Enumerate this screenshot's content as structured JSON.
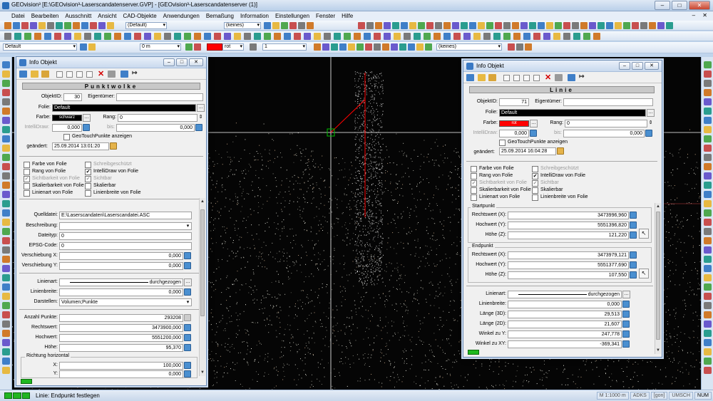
{
  "window": {
    "title": "GEOvision³  [E:\\GEOvision³-Laserscandatenserver.GVP] - [GEOvision³-Laserscandatenserver (1)]",
    "min": "–",
    "max": "□",
    "close": "✕"
  },
  "menu": [
    "Datei",
    "Bearbeiten",
    "Ausschnitt",
    "Ansicht",
    "CAD-Objekte",
    "Anwendungen",
    "Bemaßung",
    "Information",
    "Einstellungen",
    "Fenster",
    "Hilfe"
  ],
  "menu_mdi_buttons": "– ✕",
  "toolbar": {
    "layer_combo": "(Default)",
    "snap_combo": "(keines)"
  },
  "toolbar2": {
    "style_combo": "Default",
    "width_combo": "0 m",
    "color_label": "rot",
    "number_value": "1",
    "keines_combo": "(keines)"
  },
  "status": {
    "message": "Linie: Endpunkt festlegen",
    "cells": [
      "M 1:1000 m",
      "ADKS",
      "[gon]",
      "UMSCH",
      "NUM"
    ]
  },
  "colors": {
    "accent_red": "#ff0000",
    "green": "#1fb81f"
  },
  "left_panel": {
    "title": "Info Objekt",
    "header": "Punktwolke",
    "objektid_label": "ObjektID:",
    "objektid": "30",
    "eigentuemer_label": "Eigentümer:",
    "folie_label": "Folie:",
    "folie": "Default",
    "farbe_label": "Farbe:",
    "farbe": "schwarz",
    "rang_label": "Rang:",
    "rang": "0",
    "intellidraw_label": "IntelliDraw:",
    "intellidraw": "0,000",
    "bis_label": "bis:",
    "bis": "0,000",
    "geotouch": "GeoTouchPunkte anzeigen",
    "geaendert_label": "geändert:",
    "geaendert": "25.09.2014 13:01:20",
    "checks_left": [
      "Farbe von Folie",
      "Rang von Folie",
      "Sichtbarkeit von Folie",
      "Skalierbarkeit von Folie",
      "Linienart von Folie"
    ],
    "checks_right": [
      "Schreibgeschützt",
      "IntelliDraw von Folie",
      "Sichtbar",
      "Skalierbar",
      "Linienbreite von Folie"
    ],
    "quelldatei_label": "Quelldatei:",
    "quelldatei": "E:\\Laserscandaten\\Laserscandatei.ASC",
    "beschreibung_label": "Beschreibung:",
    "dateityp_label": "Dateityp:",
    "dateityp": "0",
    "epsg_label": "EPSG-Code:",
    "epsg": "0",
    "verschx_label": "Verschiebung X:",
    "verschx": "0,000",
    "verschy_label": "Verschiebung Y:",
    "verschy": "0,000",
    "linienart_label": "Linienart:",
    "linienart": "durchgezogen",
    "linienbreite_label": "Linienbreite:",
    "linienbreite": "0,000",
    "darstellen_label": "Darstellen:",
    "darstellen": "Volumen;Punkte",
    "anzahl_label": "Anzahl Punkte:",
    "anzahl": "293208",
    "rechts_label": "Rechtswert:",
    "rechts": "3473900,000",
    "hoch_label": "Hochwert:",
    "hoch": "5551200,000",
    "hoehe_label": "Höhe:",
    "hoehe": "95,370",
    "richtung_label": "Richtung horizontal",
    "x_label": "X:",
    "x": "100,000",
    "y_label": "Y:",
    "y": "0,000"
  },
  "right_panel": {
    "title": "Info Objekt",
    "header": "Linie",
    "objektid_label": "ObjektID:",
    "objektid": "71",
    "eigentuemer_label": "Eigentümer:",
    "folie_label": "Folie:",
    "folie": "Default",
    "farbe_label": "Farbe:",
    "farbe": "rot",
    "rang_label": "Rang:",
    "rang": "0",
    "intellidraw_label": "IntelliDraw:",
    "intellidraw": "0,000",
    "bis_label": "bis:",
    "bis": "0,000",
    "geotouch": "GeoTouchPunkte anzeigen",
    "geaendert_label": "geändert:",
    "geaendert": "25.09.2014 16:04:28",
    "checks_left": [
      "Farbe von Folie",
      "Rang von Folie",
      "Sichtbarkeit von Folie",
      "Skalierbarkeit von Folie",
      "Linienart von Folie"
    ],
    "checks_right": [
      "Schreibgeschützt",
      "IntelliDraw von Folie",
      "Sichtbar",
      "Skalierbar",
      "Linienbreite von Folie"
    ],
    "startpunkt_label": "Startpunkt",
    "s_rechts_label": "Rechtswert (X):",
    "s_rechts": "3473996,960",
    "s_hoch_label": "Hochwert (Y):",
    "s_hoch": "5551396,820",
    "s_hoehe_label": "Höhe (Z):",
    "s_hoehe": "121,220",
    "endpunkt_label": "Endpunkt",
    "e_rechts_label": "Rechtswert (X):",
    "e_rechts": "3473979,121",
    "e_hoch_label": "Hochwert (Y):",
    "e_hoch": "5551377,690",
    "e_hoehe_label": "Höhe (Z):",
    "e_hoehe": "107,550",
    "linienart_label": "Linienart:",
    "linienart": "durchgezogen",
    "linienbreite_label": "Linienbreite:",
    "linienbreite": "0,000",
    "laenge3d_label": "Länge (3D):",
    "laenge3d": "29,513",
    "laenge2d_label": "Länge (2D):",
    "laenge2d": "21,607",
    "winkely_label": "Winkel zu Y:",
    "winkely": "247,778",
    "winkelxy_label": "Winkel zu XY:",
    "winkelxy": "-369,341"
  }
}
